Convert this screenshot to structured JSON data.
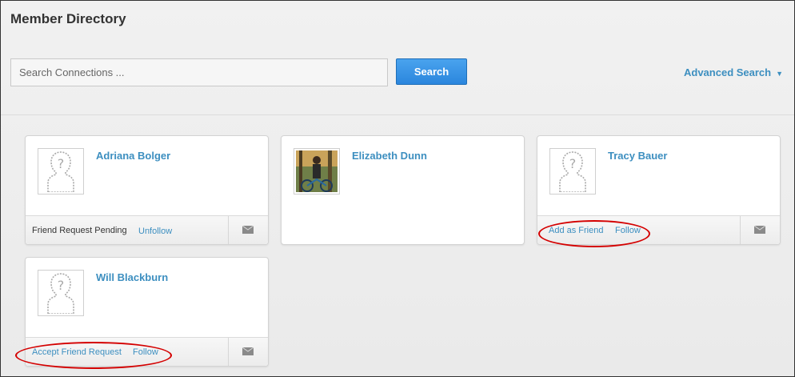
{
  "page": {
    "title": "Member Directory"
  },
  "search": {
    "placeholder": "Search Connections ...",
    "button_label": "Search",
    "advanced_label": "Advanced Search",
    "advanced_caret": "▼"
  },
  "cards": [
    {
      "name": "Adriana Bolger",
      "avatar": "placeholder-avatar-icon",
      "status_text": "Friend Request Pending",
      "action_link": "Unfollow",
      "message_icon": "envelope-icon"
    },
    {
      "name": "Elizabeth Dunn",
      "avatar": "photo"
    },
    {
      "name": "Tracy Bauer",
      "avatar": "placeholder-avatar-icon",
      "friend_link": "Add as Friend",
      "follow_link": "Follow",
      "message_icon": "envelope-icon"
    },
    {
      "name": "Will Blackburn",
      "avatar": "placeholder-avatar-icon",
      "friend_link": "Accept Friend Request",
      "follow_link": "Follow",
      "message_icon": "envelope-icon"
    }
  ],
  "colors": {
    "link": "#3d8fc0",
    "search_button": "#2f8ee0",
    "highlight_oval": "#d40000"
  }
}
